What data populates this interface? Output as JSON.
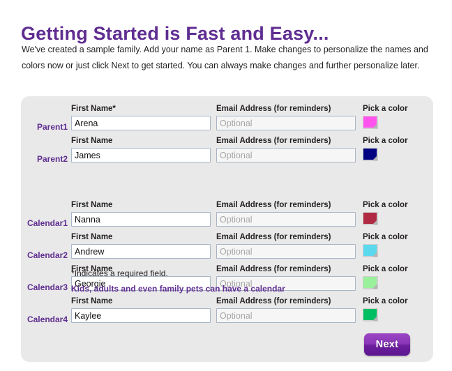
{
  "header": {
    "title": "Getting Started is Fast and Easy...",
    "intro_line1": "We've created a sample family. Add your name as Parent 1. Make changes to personalize the names and colors now",
    "intro_line2": "or just click Next to get started. You can always make changes and further personalize later."
  },
  "form": {
    "column_headers": {
      "name_required": "First Name*",
      "name": "First Name",
      "email": "Email Address (for reminders)",
      "color": "Pick a color"
    },
    "email_placeholder": "Optional",
    "required_note": "*Indicates a required field.",
    "section_note": "Kids, adults and even family pets can have a calendar",
    "rows": [
      {
        "label": "Parent1",
        "name_label": "First Name*",
        "name_value": "Arena",
        "email_label": "Email Address (for reminders)",
        "email_value": "",
        "color_label": "Pick a color",
        "color": "#ff55ee"
      },
      {
        "label": "Parent2",
        "name_label": "First Name",
        "name_value": "James",
        "email_label": "Email Address (for reminders)",
        "email_value": "",
        "color_label": "Pick a color",
        "color": "#000080"
      },
      {
        "label": "Calendar1",
        "name_label": "First Name",
        "name_value": "Nanna",
        "email_label": "Email Address (for reminders)",
        "email_value": "",
        "color_label": "Pick a color",
        "color": "#b02a43"
      },
      {
        "label": "Calendar2",
        "name_label": "First Name",
        "name_value": "Andrew",
        "email_label": "Email Address (for reminders)",
        "email_value": "",
        "color_label": "Pick a color",
        "color": "#5cd8ef"
      },
      {
        "label": "Calendar3",
        "name_label": "First Name",
        "name_value": "Georgie",
        "email_label": "Email Address (for reminders)",
        "email_value": "",
        "color_label": "Pick a color",
        "color": "#9bf09b"
      },
      {
        "label": "Calendar4",
        "name_label": "First Name",
        "name_value": "Kaylee",
        "email_label": "Email Address (for reminders)",
        "email_value": "",
        "color_label": "Pick a color",
        "color": "#00bf63"
      }
    ]
  },
  "footer": {
    "next_label": "Next"
  },
  "colors": {
    "brand_purple": "#5f2d91",
    "panel_background": "#e9e9e9",
    "page_background": "#ffffff",
    "input_border": "#a9b6c6"
  }
}
